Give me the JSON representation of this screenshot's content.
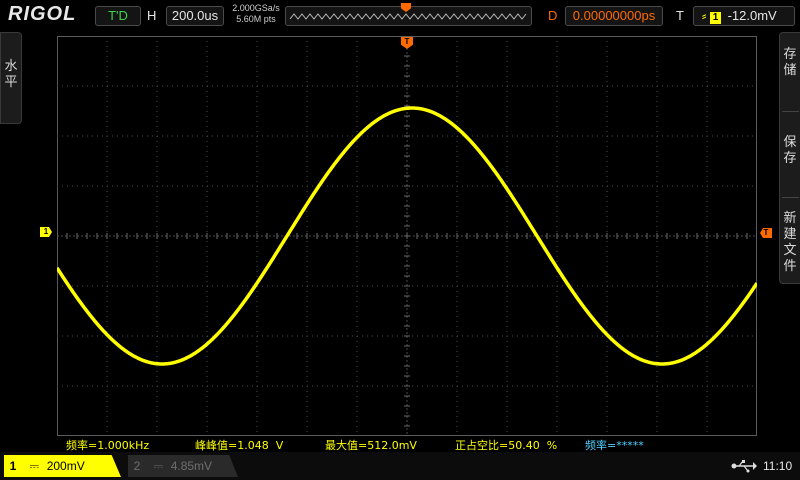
{
  "header": {
    "brand": "RIGOL",
    "run_status": "T'D",
    "horizontal_label": "H",
    "timebase": "200.0us",
    "sample_rate": "2.000GSa/s",
    "memory_depth": "5.60M pts",
    "delay_label": "D",
    "delay_value": "0.00000000ps",
    "trigger_label": "T",
    "trigger_channel": "1",
    "trigger_level": "-12.0mV"
  },
  "left_menu": {
    "label": "水平"
  },
  "right_menu": {
    "items": [
      "存储",
      "保存",
      "新建文件"
    ]
  },
  "markers": {
    "ch1_ref": "1",
    "trigger_level_marker": "T",
    "trigger_pos_marker": "T"
  },
  "measurements": {
    "frequency": "频率=1.000kHz",
    "peak_to_peak": "峰峰值=1.048  V",
    "maximum": "最大值=512.0mV",
    "duty_cycle": "正占空比=50.40  %",
    "frequency2": "频率=*****"
  },
  "channels": {
    "ch1": {
      "number": "1",
      "coupling": "⎓",
      "scale": "200mV"
    },
    "ch2": {
      "number": "2",
      "coupling": "⎓",
      "scale": "4.85mV"
    }
  },
  "status": {
    "time": "11:10",
    "usb_icon": "usb-icon"
  },
  "colors": {
    "ch1": "#ffff00",
    "delay": "#ff6a00",
    "run": "#3cd24a",
    "meas_disabled": "#4fd0ff"
  },
  "chart_data": {
    "type": "line",
    "series": [
      {
        "x": [
          0,
          100,
          200,
          300,
          400,
          500,
          600,
          700,
          800,
          900,
          1000,
          1100,
          1200,
          1300,
          1400
        ],
        "y": [
          -160,
          -394,
          -512,
          -400,
          -165,
          160,
          394,
          512,
          400,
          165,
          -160,
          -394,
          -512,
          -400,
          -165
        ]
      }
    ],
    "xlim": [
      -10,
      1390
    ],
    "ylim": [
      -800,
      800
    ],
    "grid": true,
    "waveform": "sine"
  }
}
